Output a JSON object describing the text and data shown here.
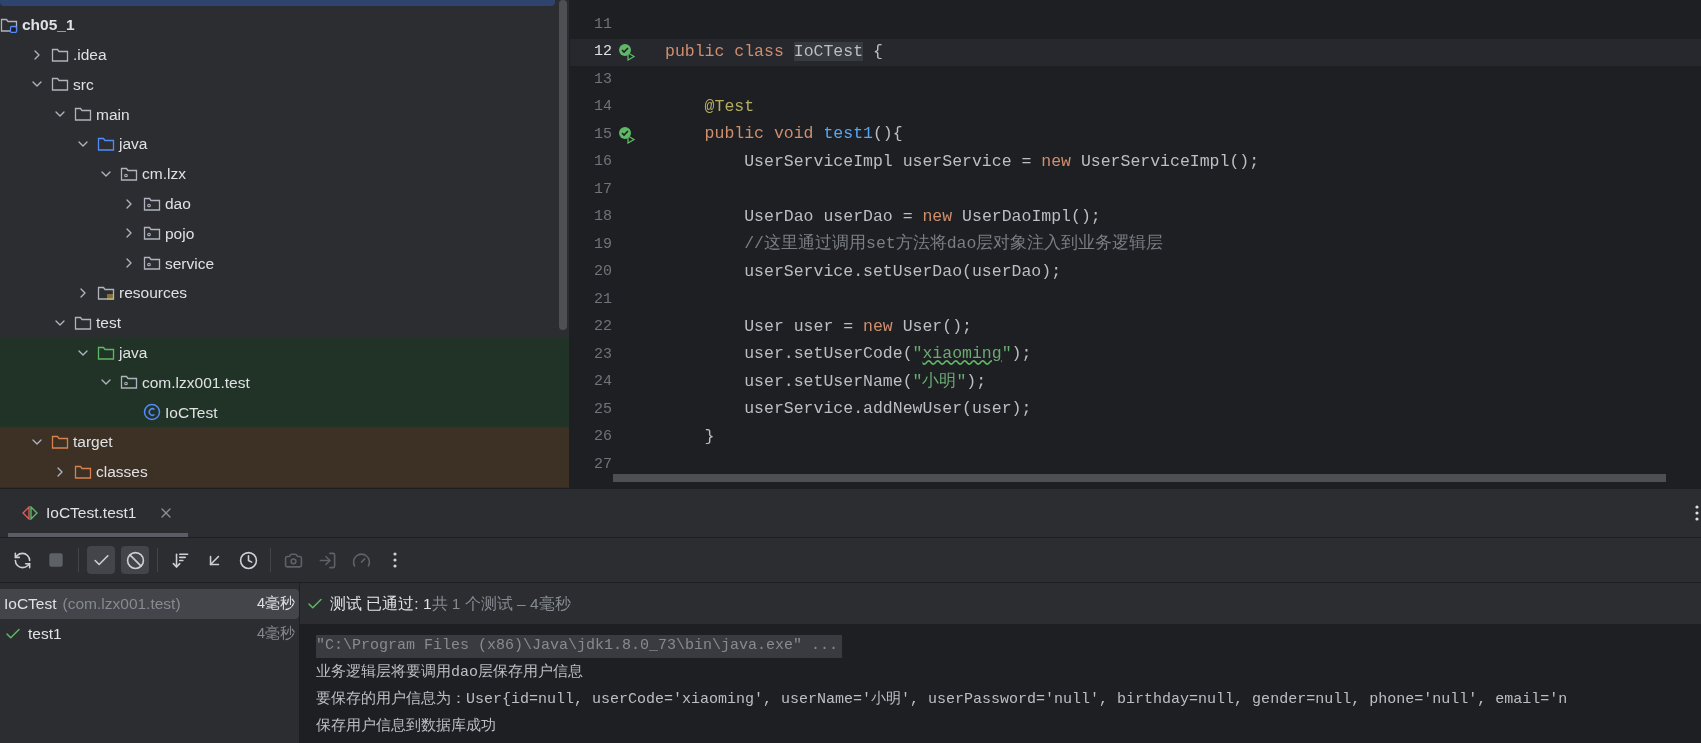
{
  "project_tree": {
    "items": [
      {
        "label": "ch05_1",
        "kind": "module",
        "selected": false,
        "children": [
          {
            "label": ".idea",
            "kind": "folder",
            "expanded": false,
            "selected": false
          },
          {
            "label": "src",
            "kind": "folder",
            "expanded": true,
            "selected": false,
            "children": [
              {
                "label": "main",
                "kind": "folder",
                "expanded": true,
                "selected": false,
                "children": [
                  {
                    "label": "java",
                    "kind": "source-root",
                    "expanded": true,
                    "selected": false,
                    "children": [
                      {
                        "label": "cm.lzx",
                        "kind": "package",
                        "expanded": true,
                        "selected": false,
                        "children": [
                          {
                            "label": "dao",
                            "kind": "package",
                            "expanded": false,
                            "selected": false
                          },
                          {
                            "label": "pojo",
                            "kind": "package",
                            "expanded": false,
                            "selected": false
                          },
                          {
                            "label": "service",
                            "kind": "package",
                            "expanded": false,
                            "selected": false
                          }
                        ]
                      }
                    ]
                  },
                  {
                    "label": "resources",
                    "kind": "resources",
                    "expanded": false,
                    "selected": false
                  }
                ]
              },
              {
                "label": "test",
                "kind": "folder",
                "expanded": true,
                "selected": false,
                "children": [
                  {
                    "label": "java",
                    "kind": "test-root",
                    "expanded": true,
                    "selected": false,
                    "children": [
                      {
                        "label": "com.lzx001.test",
                        "kind": "package",
                        "expanded": true,
                        "selected": false,
                        "children": [
                          {
                            "label": "IoCTest",
                            "kind": "class",
                            "selected": false
                          }
                        ]
                      }
                    ]
                  }
                ]
              }
            ]
          },
          {
            "label": "target",
            "kind": "excluded",
            "expanded": true,
            "selected": false,
            "children": [
              {
                "label": "classes",
                "kind": "excluded",
                "expanded": false,
                "selected": false
              }
            ]
          }
        ]
      }
    ]
  },
  "editor": {
    "lines": [
      {
        "number": "11",
        "kind": "code",
        "current": false
      },
      {
        "number": "12",
        "kind": "test",
        "current": true,
        "tokens": [
          {
            "kind": "keyword",
            "text": "public class "
          },
          {
            "kind": "highlight",
            "text": "IoCTest"
          },
          {
            "kind": "plain",
            "text": " {"
          }
        ]
      },
      {
        "number": "13",
        "kind": "code",
        "current": false
      },
      {
        "number": "14",
        "kind": "code",
        "current": false,
        "tokens": [
          {
            "kind": "annotation",
            "text": "    @Test"
          }
        ]
      },
      {
        "number": "15",
        "kind": "test",
        "current": false,
        "tokens": [
          {
            "kind": "keyword",
            "text": "    public void "
          },
          {
            "kind": "method",
            "text": "test1"
          },
          {
            "kind": "plain",
            "text": "(){"
          }
        ]
      },
      {
        "number": "16",
        "kind": "code",
        "current": false,
        "tokens": [
          {
            "kind": "plain",
            "text": "        UserServiceImpl userService = "
          },
          {
            "kind": "keyword",
            "text": "new"
          },
          {
            "kind": "plain",
            "text": " UserServiceImpl();"
          }
        ]
      },
      {
        "number": "17",
        "kind": "code",
        "current": false
      },
      {
        "number": "18",
        "kind": "code",
        "current": false,
        "tokens": [
          {
            "kind": "plain",
            "text": "        UserDao userDao = "
          },
          {
            "kind": "keyword",
            "text": "new"
          },
          {
            "kind": "plain",
            "text": " UserDaoImpl();"
          }
        ]
      },
      {
        "number": "19",
        "kind": "code",
        "current": false,
        "tokens": [
          {
            "kind": "comment",
            "text": "        //这里通过调用set方法将dao层对象注入到业务逻辑层"
          }
        ]
      },
      {
        "number": "20",
        "kind": "code",
        "current": false,
        "tokens": [
          {
            "kind": "plain",
            "text": "        userService.setUserDao(userDao);"
          }
        ]
      },
      {
        "number": "21",
        "kind": "code",
        "current": false
      },
      {
        "number": "22",
        "kind": "code",
        "current": false,
        "tokens": [
          {
            "kind": "plain",
            "text": "        User user = "
          },
          {
            "kind": "keyword",
            "text": "new"
          },
          {
            "kind": "plain",
            "text": " User();"
          }
        ]
      },
      {
        "number": "23",
        "kind": "code",
        "current": false,
        "tokens": [
          {
            "kind": "plain",
            "text": "        user.setUserCode("
          },
          {
            "kind": "string",
            "text": "\""
          },
          {
            "kind": "typo",
            "text": "xiaoming"
          },
          {
            "kind": "string",
            "text": "\""
          },
          {
            "kind": "plain",
            "text": ");"
          }
        ]
      },
      {
        "number": "24",
        "kind": "code",
        "current": false,
        "tokens": [
          {
            "kind": "plain",
            "text": "        user.setUserName("
          },
          {
            "kind": "string",
            "text": "\"小明\""
          },
          {
            "kind": "plain",
            "text": ");"
          }
        ]
      },
      {
        "number": "25",
        "kind": "code",
        "current": false,
        "tokens": [
          {
            "kind": "plain",
            "text": "        userService.addNewUser(user);"
          }
        ]
      },
      {
        "number": "26",
        "kind": "code",
        "current": false,
        "tokens": [
          {
            "kind": "plain",
            "text": "    }"
          }
        ]
      },
      {
        "number": "27",
        "kind": "code",
        "current": false
      }
    ]
  },
  "run_panel": {
    "tab": {
      "label": "IoCTest.test1",
      "selected": true
    },
    "toolbar": [
      {
        "kind": "rerun",
        "selected": false,
        "disabled": false
      },
      {
        "kind": "stop",
        "selected": false,
        "disabled": true
      },
      {
        "kind": "show-passed",
        "selected": true,
        "disabled": false
      },
      {
        "kind": "show-ignored",
        "selected": true,
        "disabled": false
      },
      {
        "kind": "sort",
        "selected": false,
        "disabled": false
      },
      {
        "kind": "collapse",
        "selected": false,
        "disabled": false
      },
      {
        "kind": "history",
        "selected": false,
        "disabled": false
      },
      {
        "kind": "camera",
        "selected": false,
        "disabled": true
      },
      {
        "kind": "import",
        "selected": false,
        "disabled": true
      },
      {
        "kind": "gauge",
        "selected": false,
        "disabled": true
      },
      {
        "kind": "more",
        "selected": false,
        "disabled": false
      }
    ],
    "tests": [
      {
        "name": "IoCTest",
        "package": "(com.lzx001.test)",
        "time": "4毫秒",
        "selected": true,
        "passed": false
      },
      {
        "name": "test1",
        "time": "4毫秒",
        "selected": false,
        "passed": true
      }
    ],
    "status": {
      "passed": "测试 已通过: 1",
      "summary": "共 1 个测试 – 4毫秒"
    },
    "console": [
      {
        "kind": "command",
        "text": "\"C:\\Program Files (x86)\\Java\\jdk1.8.0_73\\bin\\java.exe\" ..."
      },
      {
        "kind": "output",
        "text": "业务逻辑层将要调用dao层保存用户信息"
      },
      {
        "kind": "output",
        "text": "要保存的用户信息为：User{id=null, userCode='xiaoming', userName='小明', userPassword='null', birthday=null, gender=null, phone='null', email='n"
      },
      {
        "kind": "output",
        "text": "保存用户信息到数据库成功"
      }
    ]
  }
}
